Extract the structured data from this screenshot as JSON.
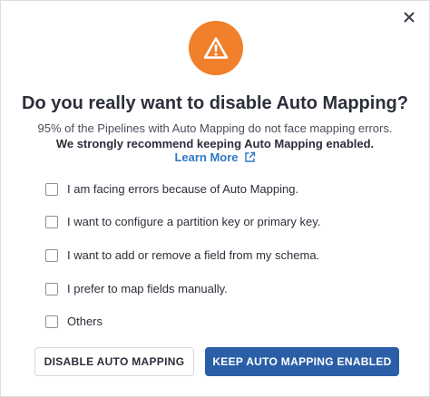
{
  "dialog": {
    "title": "Do you really want to disable Auto Mapping?",
    "subtitle": "95% of the Pipelines with Auto Mapping do not face mapping errors.",
    "recommendation": "We strongly recommend keeping Auto Mapping enabled.",
    "learn_more": "Learn More",
    "close_icon": "close-icon",
    "warning_icon": "warning-icon",
    "external_link_icon": "external-link-icon",
    "warning_color": "#f0802b",
    "accent_color": "#2a5fa7",
    "link_color": "#2f78c4"
  },
  "options": [
    {
      "label": "I am facing errors because of Auto Mapping.",
      "checked": false
    },
    {
      "label": "I want to configure a partition key or primary key.",
      "checked": false
    },
    {
      "label": "I want to add or remove a field from my schema.",
      "checked": false
    },
    {
      "label": "I prefer to map fields manually.",
      "checked": false
    },
    {
      "label": "Others",
      "checked": false
    }
  ],
  "buttons": {
    "disable_label": "DISABLE AUTO MAPPING",
    "keep_label": "KEEP AUTO MAPPING ENABLED"
  }
}
